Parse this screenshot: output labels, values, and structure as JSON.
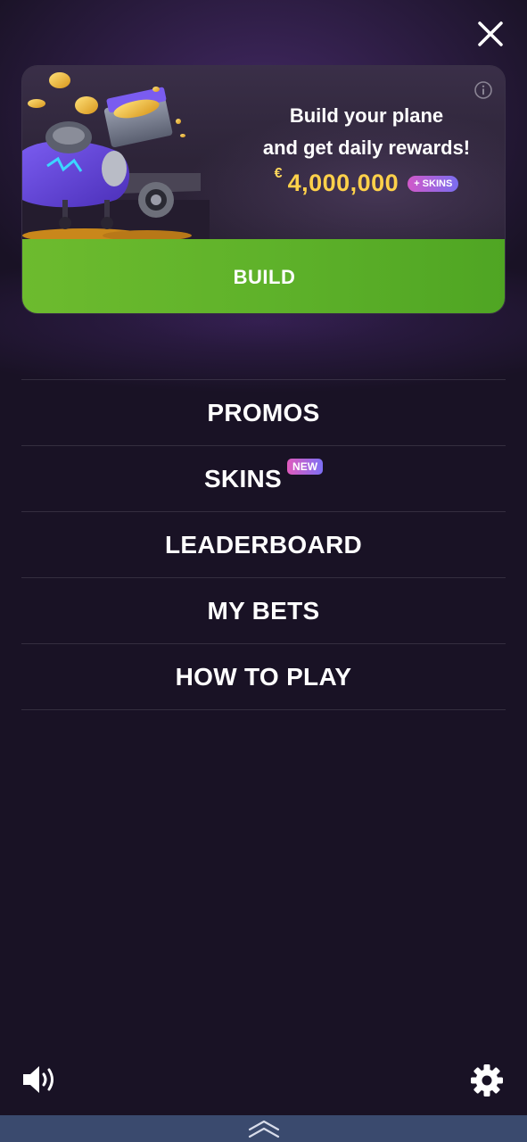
{
  "promo": {
    "title_line1": "Build your plane",
    "title_line2": "and get daily rewards!",
    "currency": "€",
    "prize_amount": "4,000,000",
    "skins_tag": "+ SKINS",
    "build_label": "BUILD"
  },
  "menu": {
    "items": [
      {
        "label": "PROMOS"
      },
      {
        "label": "SKINS",
        "badge": "NEW"
      },
      {
        "label": "LEADERBOARD"
      },
      {
        "label": "MY BETS"
      },
      {
        "label": "HOW TO PLAY"
      }
    ]
  },
  "icons": {
    "close": "close-icon",
    "info": "info-icon",
    "sound": "speaker-icon",
    "settings": "gear-icon",
    "expand": "chevron-double-up-icon"
  },
  "colors": {
    "background": "#191225",
    "build_button": "#5fb22a",
    "prize": "#ffd14a",
    "badge_start": "#e05bbd",
    "badge_end": "#7d6ff5",
    "bottom_bar": "#3a4a6e"
  }
}
